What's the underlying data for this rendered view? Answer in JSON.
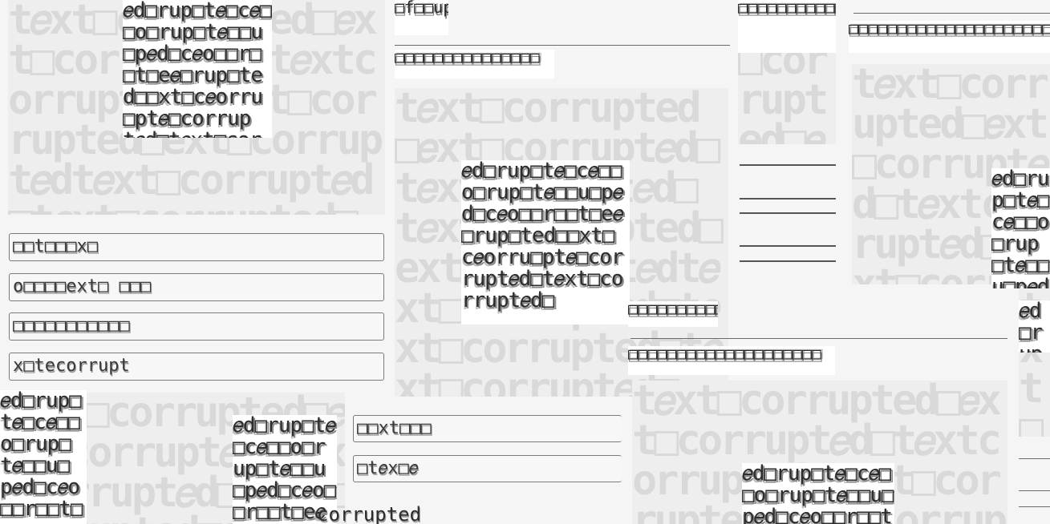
{
  "fragments": {
    "ghost_text": "t𝑒xt□corrupted□𝑒xt□corrupt𝑒d□t𝑒xtcorrupt𝑒d□t𝑒xt□corrupted□ext□corrupt𝑒dt𝑒xt□corrupt𝑒d□t𝑒xt□corrupted□t𝑒xt□corrupt𝑒d□",
    "glyph_text": "𝑒d□rup□t𝑒□c𝑒□□o□rup□t𝑒□□u□p𝑒d□c𝑒o□□r□□t□e𝑒□rup□ted□□xt□c𝑒orru□pt𝑒□corrupt𝑒d□t𝑒xt□corrupt𝑒d□",
    "field_1": "□□t□□□x□",
    "field_2": "o□□□□ext□ □□□",
    "field_3": "□□□□□□□□□□□",
    "field_4": "x□tecorrupt",
    "strip_1": "□f□□up□e□□e□□",
    "strip_2": "□□□□□□□□□□□□□□□",
    "strip_3": "□□□□□□□□□□□□□□□□□□□□□□□□",
    "strip_4": "□□□□□□□□□□□□□□□□□□□□",
    "strip_5": "□□□□□□□□□□□□□□",
    "field_5": "□□xt□□□",
    "field_6": "□t𝑒x□𝑒",
    "bottom_text": "corrupted"
  }
}
